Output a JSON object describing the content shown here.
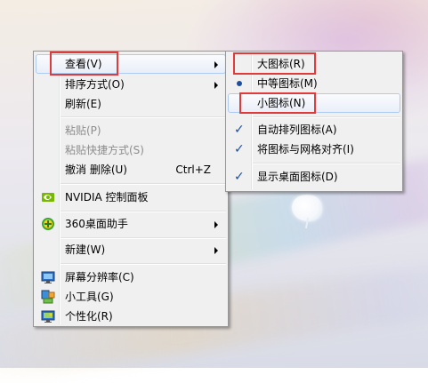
{
  "main_menu": {
    "items": [
      {
        "label": "查看(V)"
      },
      {
        "label": "排序方式(O)"
      },
      {
        "label": "刷新(E)"
      },
      {
        "label": "粘贴(P)"
      },
      {
        "label": "粘贴快捷方式(S)"
      },
      {
        "label": "撤消 删除(U)",
        "shortcut": "Ctrl+Z"
      },
      {
        "label": "NVIDIA 控制面板",
        "icon": "nvidia-icon"
      },
      {
        "label": "360桌面助手",
        "icon": "360-assistant-icon"
      },
      {
        "label": "新建(W)"
      },
      {
        "label": "屏幕分辨率(C)",
        "icon": "monitor-resolution-icon"
      },
      {
        "label": "小工具(G)",
        "icon": "gadgets-icon"
      },
      {
        "label": "个性化(R)",
        "icon": "personalize-icon"
      }
    ]
  },
  "view_submenu": {
    "items": [
      {
        "label": "大图标(R)"
      },
      {
        "label": "中等图标(M)",
        "selected": true
      },
      {
        "label": "小图标(N)"
      },
      {
        "label": "自动排列图标(A)",
        "checked": true
      },
      {
        "label": "将图标与网格对齐(I)",
        "checked": true
      },
      {
        "label": "显示桌面图标(D)",
        "checked": true
      }
    ]
  },
  "colors": {
    "annotation_red": "#e03a3a",
    "highlight_border": "#aeccf3",
    "menu_bg": "#f0f0f0"
  }
}
